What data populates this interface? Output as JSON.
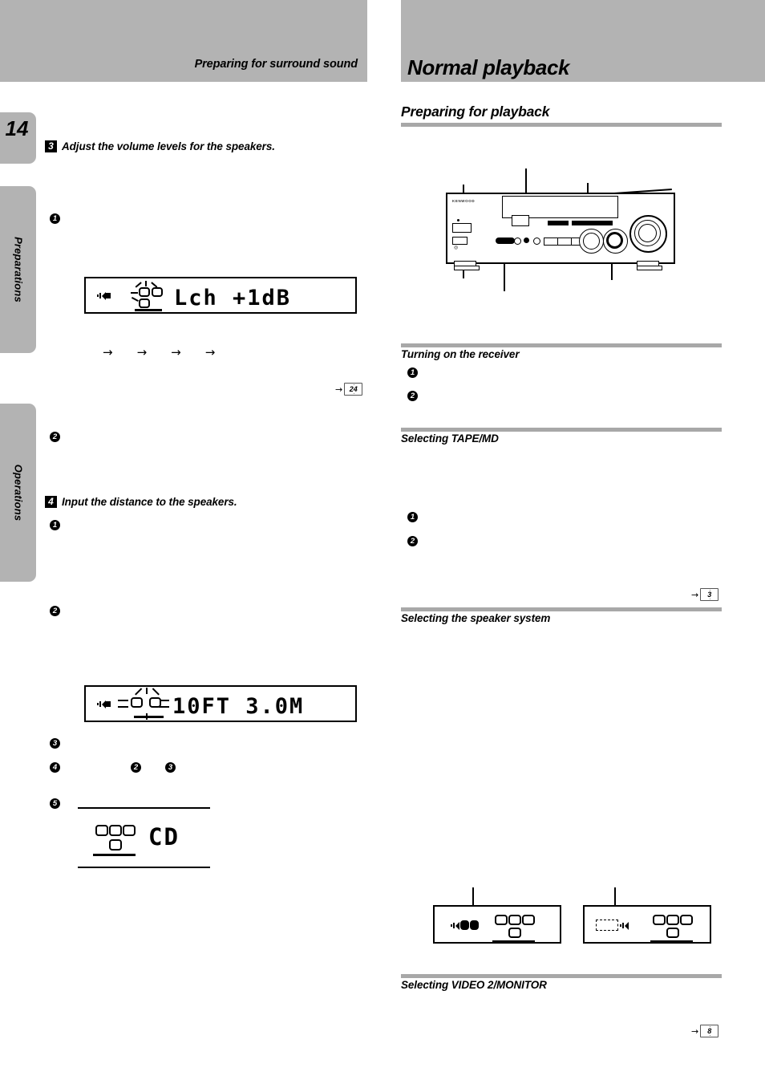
{
  "page": {
    "number": "14",
    "running_head_left": "Preparing for surround sound",
    "chapter_title": "Normal playback"
  },
  "side_tabs": [
    {
      "label": "Preparations"
    },
    {
      "label": "Operations"
    }
  ],
  "left_column": {
    "steps": [
      {
        "num": "3",
        "title": "Adjust the volume levels for the speakers.",
        "bullets": [
          "1",
          "2"
        ]
      },
      {
        "num": "4",
        "title": "Input the distance to the speakers.",
        "bullets": [
          "1",
          "2",
          "3",
          "4",
          "5"
        ]
      }
    ],
    "inline_refs": [
      "2",
      "3"
    ],
    "arrows": [
      "→",
      "→",
      "→",
      "→"
    ],
    "page_ref": {
      "arrow": "→",
      "number": "24"
    },
    "lcd_level": {
      "name": "level-display",
      "speaker_icon": "speaker-icon",
      "text": "Lch  +1dB"
    },
    "lcd_distance": {
      "name": "distance-display",
      "speaker_icon": "speaker-icon",
      "text": "10FT  3.0M"
    },
    "lcd_source": {
      "name": "source-display",
      "text": "CD"
    }
  },
  "right_column": {
    "main_section": "Preparing for playback",
    "sections": [
      {
        "title": "Turning on the receiver",
        "bullets": [
          "1",
          "2"
        ]
      },
      {
        "title": "Selecting TAPE/MD",
        "bullets": [
          "1",
          "2"
        ],
        "page_ref": {
          "arrow": "→",
          "number": "3"
        }
      },
      {
        "title": "Selecting the speaker system",
        "bullets": []
      },
      {
        "title": "Selecting VIDEO 2/MONITOR",
        "bullets": [],
        "page_ref": {
          "arrow": "→",
          "number": "8"
        }
      }
    ],
    "receiver": {
      "name": "receiver-front-panel",
      "brand": "KENWOOD"
    },
    "speaker_displays": [
      {
        "name": "speaker-a-on-display",
        "state": "filled"
      },
      {
        "name": "speaker-b-off-display",
        "state": "dashed"
      }
    ]
  },
  "colors": {
    "band": "#b3b3b3",
    "rule": "#a8a8a8",
    "ink": "#000000",
    "paper": "#ffffff"
  }
}
